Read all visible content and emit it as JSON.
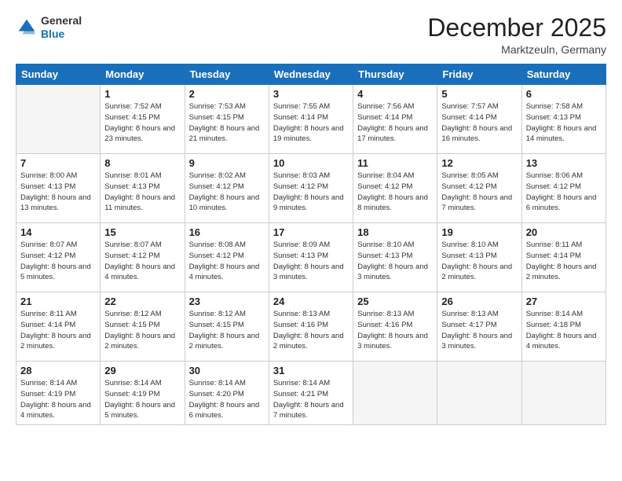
{
  "header": {
    "logo": {
      "line1": "General",
      "line2": "Blue"
    },
    "title": "December 2025",
    "location": "Marktzeuln, Germany"
  },
  "days_of_week": [
    "Sunday",
    "Monday",
    "Tuesday",
    "Wednesday",
    "Thursday",
    "Friday",
    "Saturday"
  ],
  "weeks": [
    [
      {
        "day": "",
        "sunrise": "",
        "sunset": "",
        "daylight": ""
      },
      {
        "day": "1",
        "sunrise": "Sunrise: 7:52 AM",
        "sunset": "Sunset: 4:15 PM",
        "daylight": "Daylight: 8 hours and 23 minutes."
      },
      {
        "day": "2",
        "sunrise": "Sunrise: 7:53 AM",
        "sunset": "Sunset: 4:15 PM",
        "daylight": "Daylight: 8 hours and 21 minutes."
      },
      {
        "day": "3",
        "sunrise": "Sunrise: 7:55 AM",
        "sunset": "Sunset: 4:14 PM",
        "daylight": "Daylight: 8 hours and 19 minutes."
      },
      {
        "day": "4",
        "sunrise": "Sunrise: 7:56 AM",
        "sunset": "Sunset: 4:14 PM",
        "daylight": "Daylight: 8 hours and 17 minutes."
      },
      {
        "day": "5",
        "sunrise": "Sunrise: 7:57 AM",
        "sunset": "Sunset: 4:14 PM",
        "daylight": "Daylight: 8 hours and 16 minutes."
      },
      {
        "day": "6",
        "sunrise": "Sunrise: 7:58 AM",
        "sunset": "Sunset: 4:13 PM",
        "daylight": "Daylight: 8 hours and 14 minutes."
      }
    ],
    [
      {
        "day": "7",
        "sunrise": "Sunrise: 8:00 AM",
        "sunset": "Sunset: 4:13 PM",
        "daylight": "Daylight: 8 hours and 13 minutes."
      },
      {
        "day": "8",
        "sunrise": "Sunrise: 8:01 AM",
        "sunset": "Sunset: 4:13 PM",
        "daylight": "Daylight: 8 hours and 11 minutes."
      },
      {
        "day": "9",
        "sunrise": "Sunrise: 8:02 AM",
        "sunset": "Sunset: 4:12 PM",
        "daylight": "Daylight: 8 hours and 10 minutes."
      },
      {
        "day": "10",
        "sunrise": "Sunrise: 8:03 AM",
        "sunset": "Sunset: 4:12 PM",
        "daylight": "Daylight: 8 hours and 9 minutes."
      },
      {
        "day": "11",
        "sunrise": "Sunrise: 8:04 AM",
        "sunset": "Sunset: 4:12 PM",
        "daylight": "Daylight: 8 hours and 8 minutes."
      },
      {
        "day": "12",
        "sunrise": "Sunrise: 8:05 AM",
        "sunset": "Sunset: 4:12 PM",
        "daylight": "Daylight: 8 hours and 7 minutes."
      },
      {
        "day": "13",
        "sunrise": "Sunrise: 8:06 AM",
        "sunset": "Sunset: 4:12 PM",
        "daylight": "Daylight: 8 hours and 6 minutes."
      }
    ],
    [
      {
        "day": "14",
        "sunrise": "Sunrise: 8:07 AM",
        "sunset": "Sunset: 4:12 PM",
        "daylight": "Daylight: 8 hours and 5 minutes."
      },
      {
        "day": "15",
        "sunrise": "Sunrise: 8:07 AM",
        "sunset": "Sunset: 4:12 PM",
        "daylight": "Daylight: 8 hours and 4 minutes."
      },
      {
        "day": "16",
        "sunrise": "Sunrise: 8:08 AM",
        "sunset": "Sunset: 4:12 PM",
        "daylight": "Daylight: 8 hours and 4 minutes."
      },
      {
        "day": "17",
        "sunrise": "Sunrise: 8:09 AM",
        "sunset": "Sunset: 4:13 PM",
        "daylight": "Daylight: 8 hours and 3 minutes."
      },
      {
        "day": "18",
        "sunrise": "Sunrise: 8:10 AM",
        "sunset": "Sunset: 4:13 PM",
        "daylight": "Daylight: 8 hours and 3 minutes."
      },
      {
        "day": "19",
        "sunrise": "Sunrise: 8:10 AM",
        "sunset": "Sunset: 4:13 PM",
        "daylight": "Daylight: 8 hours and 2 minutes."
      },
      {
        "day": "20",
        "sunrise": "Sunrise: 8:11 AM",
        "sunset": "Sunset: 4:14 PM",
        "daylight": "Daylight: 8 hours and 2 minutes."
      }
    ],
    [
      {
        "day": "21",
        "sunrise": "Sunrise: 8:11 AM",
        "sunset": "Sunset: 4:14 PM",
        "daylight": "Daylight: 8 hours and 2 minutes."
      },
      {
        "day": "22",
        "sunrise": "Sunrise: 8:12 AM",
        "sunset": "Sunset: 4:15 PM",
        "daylight": "Daylight: 8 hours and 2 minutes."
      },
      {
        "day": "23",
        "sunrise": "Sunrise: 8:12 AM",
        "sunset": "Sunset: 4:15 PM",
        "daylight": "Daylight: 8 hours and 2 minutes."
      },
      {
        "day": "24",
        "sunrise": "Sunrise: 8:13 AM",
        "sunset": "Sunset: 4:16 PM",
        "daylight": "Daylight: 8 hours and 2 minutes."
      },
      {
        "day": "25",
        "sunrise": "Sunrise: 8:13 AM",
        "sunset": "Sunset: 4:16 PM",
        "daylight": "Daylight: 8 hours and 3 minutes."
      },
      {
        "day": "26",
        "sunrise": "Sunrise: 8:13 AM",
        "sunset": "Sunset: 4:17 PM",
        "daylight": "Daylight: 8 hours and 3 minutes."
      },
      {
        "day": "27",
        "sunrise": "Sunrise: 8:14 AM",
        "sunset": "Sunset: 4:18 PM",
        "daylight": "Daylight: 8 hours and 4 minutes."
      }
    ],
    [
      {
        "day": "28",
        "sunrise": "Sunrise: 8:14 AM",
        "sunset": "Sunset: 4:19 PM",
        "daylight": "Daylight: 8 hours and 4 minutes."
      },
      {
        "day": "29",
        "sunrise": "Sunrise: 8:14 AM",
        "sunset": "Sunset: 4:19 PM",
        "daylight": "Daylight: 8 hours and 5 minutes."
      },
      {
        "day": "30",
        "sunrise": "Sunrise: 8:14 AM",
        "sunset": "Sunset: 4:20 PM",
        "daylight": "Daylight: 8 hours and 6 minutes."
      },
      {
        "day": "31",
        "sunrise": "Sunrise: 8:14 AM",
        "sunset": "Sunset: 4:21 PM",
        "daylight": "Daylight: 8 hours and 7 minutes."
      },
      {
        "day": "",
        "sunrise": "",
        "sunset": "",
        "daylight": ""
      },
      {
        "day": "",
        "sunrise": "",
        "sunset": "",
        "daylight": ""
      },
      {
        "day": "",
        "sunrise": "",
        "sunset": "",
        "daylight": ""
      }
    ]
  ]
}
